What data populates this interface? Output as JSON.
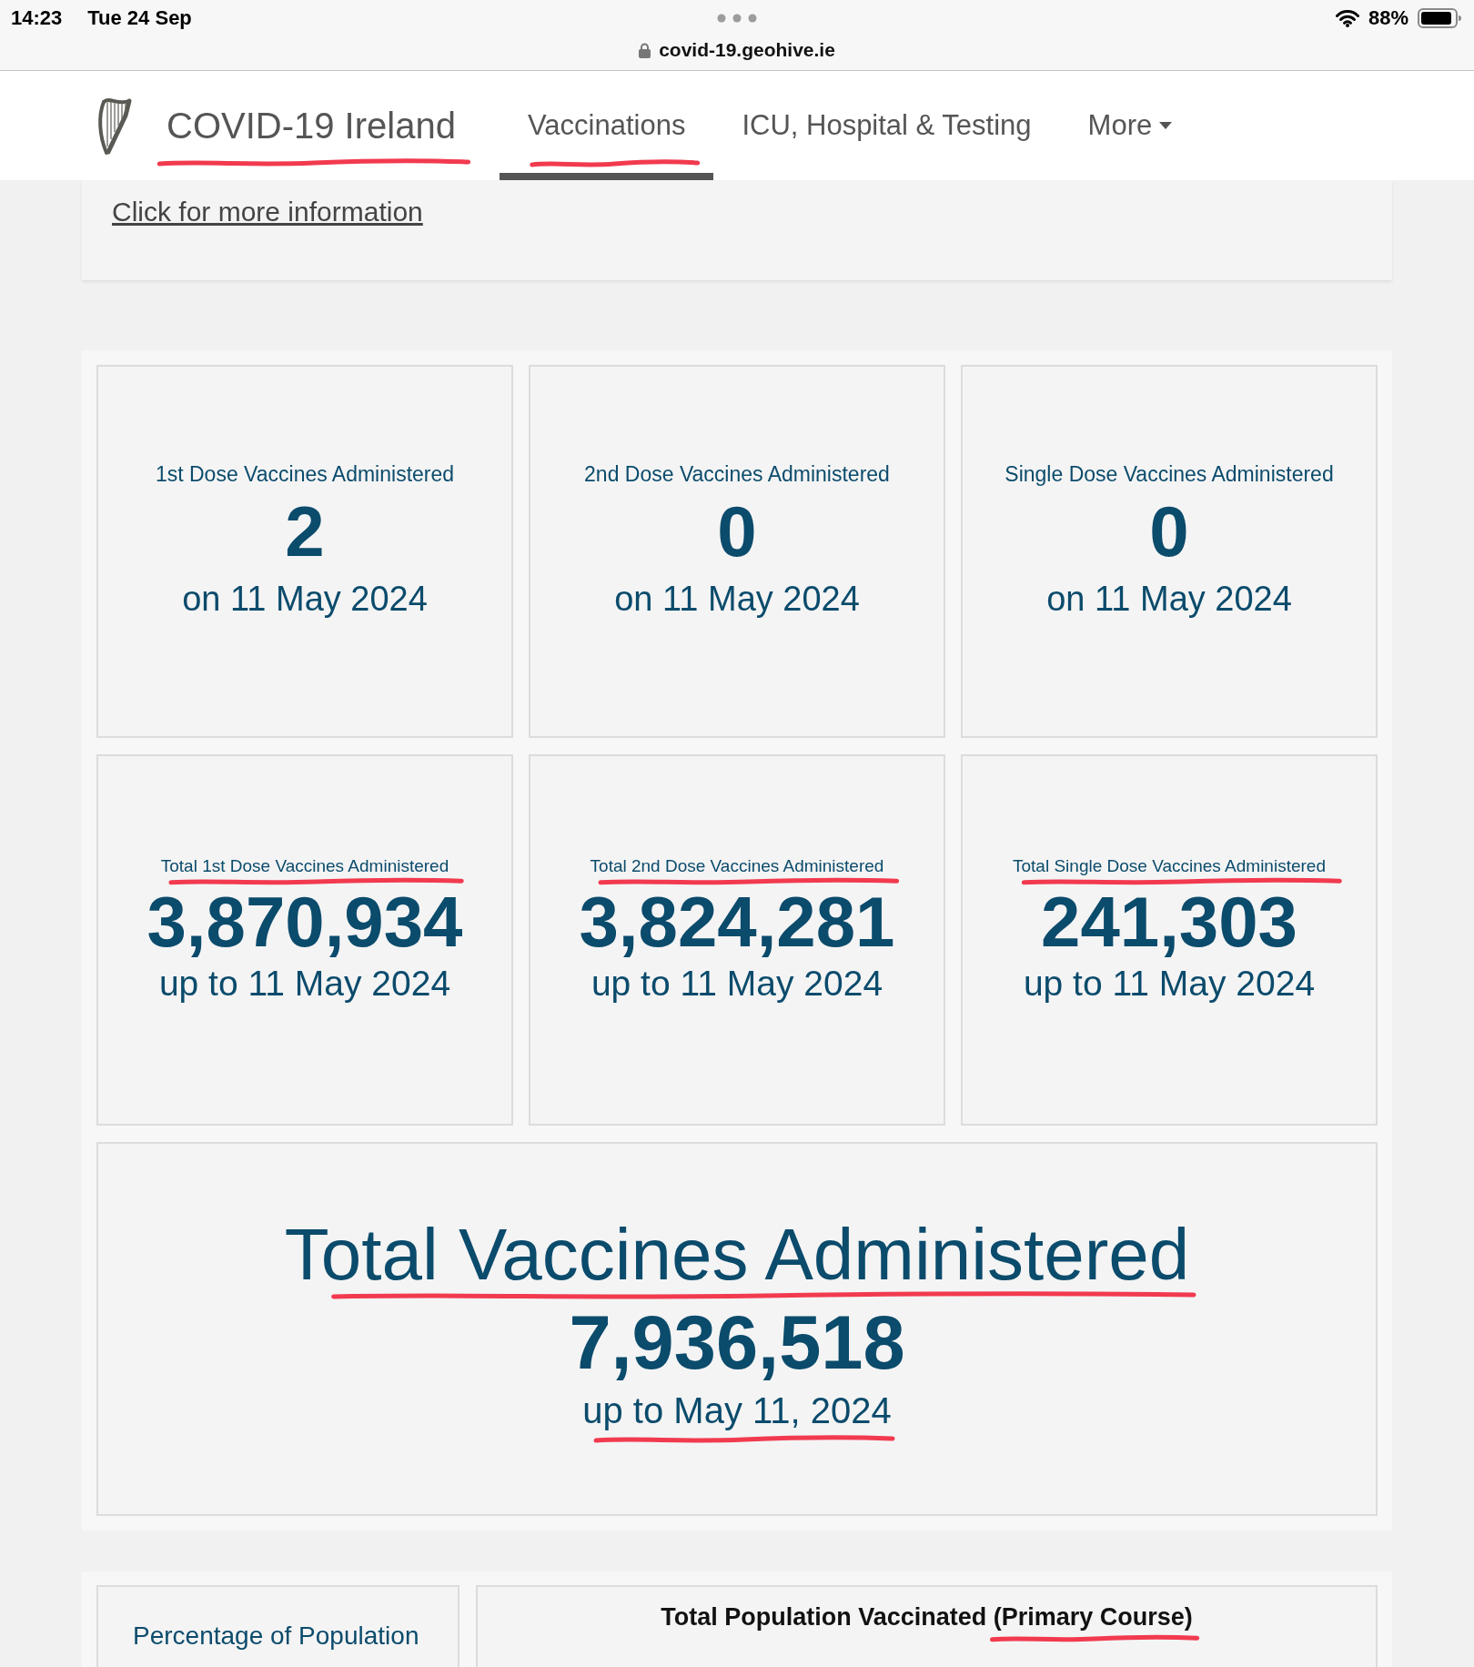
{
  "status_bar": {
    "time": "14:23",
    "date": "Tue 24 Sep",
    "battery": "88%"
  },
  "browser": {
    "url": "covid-19.geohive.ie"
  },
  "nav": {
    "brand": "COVID-19 Ireland",
    "brand_marked": true,
    "items": [
      {
        "label": "Vaccinations",
        "kind": "link",
        "selected": true,
        "marked": true
      },
      {
        "label": "ICU, Hospital & Testing",
        "kind": "link",
        "selected": false,
        "marked": false
      },
      {
        "label": "More",
        "kind": "dropdown",
        "selected": false,
        "marked": false
      }
    ]
  },
  "info": {
    "link": "Click for more information"
  },
  "daily_cards": [
    {
      "title": "1st Dose Vaccines Administered",
      "value": "2",
      "date": "on 11 May 2024"
    },
    {
      "title": "2nd Dose Vaccines Administered",
      "value": "0",
      "date": "on 11 May 2024"
    },
    {
      "title": "Single Dose Vaccines Administered",
      "value": "0",
      "date": "on 11 May 2024"
    }
  ],
  "total_cards": [
    {
      "title": "Total 1st Dose Vaccines Administered",
      "value": "3,870,934",
      "date": "up to 11 May 2024",
      "marked": true
    },
    {
      "title": "Total 2nd Dose Vaccines Administered",
      "value": "3,824,281",
      "date": "up to 11 May 2024",
      "marked": true
    },
    {
      "title": "Total Single Dose Vaccines Administered",
      "value": "241,303",
      "date": "up to 11 May 2024",
      "marked": true
    }
  ],
  "grand_total": {
    "title": "Total Vaccines Administered",
    "title_marked": true,
    "value": "7,936,518",
    "date": "up to May 11, 2024",
    "date_marked": true
  },
  "population": {
    "left_title": "Percentage of Population",
    "right_title": "Total Population Vaccinated (Primary Course)",
    "right_title_marked": true
  }
}
